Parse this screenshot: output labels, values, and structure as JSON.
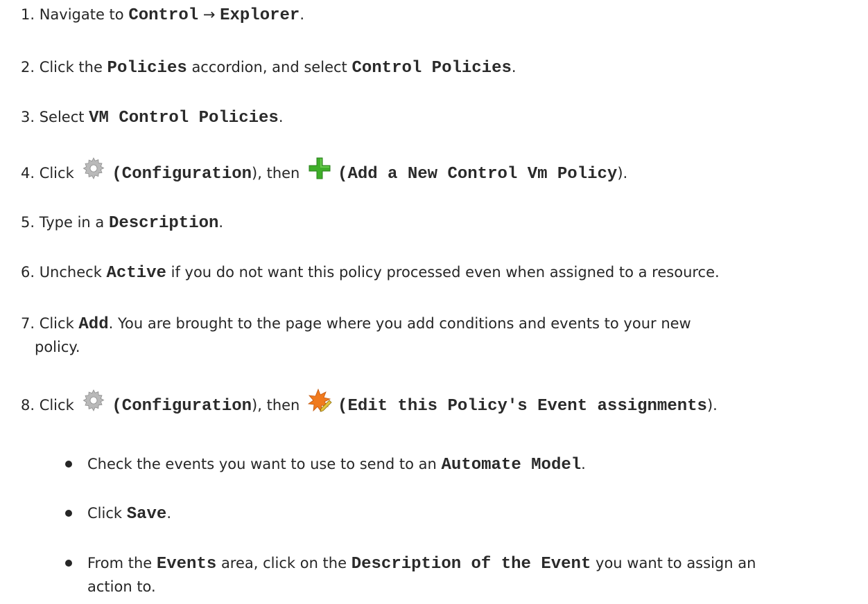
{
  "steps": [
    {
      "num": "1.",
      "parts": {
        "a": "Navigate to ",
        "b": "Control",
        "c": " → ",
        "d": "Explorer",
        "e": "."
      }
    },
    {
      "num": "2.",
      "parts": {
        "a": "Click the ",
        "b": "Policies",
        "c": " accordion, and select ",
        "d": "Control Policies",
        "e": "."
      }
    },
    {
      "num": "3.",
      "parts": {
        "a": "Select ",
        "b": "VM Control Policies",
        "c": "."
      }
    },
    {
      "num": "4.",
      "parts": {
        "a": "Click ",
        "b": "(Configuration",
        "c": "), then ",
        "d": "(Add a New Control Vm Policy",
        "e": ")."
      }
    },
    {
      "num": "5.",
      "parts": {
        "a": "Type in a ",
        "b": "Description",
        "c": "."
      }
    },
    {
      "num": "6.",
      "parts": {
        "a": "Uncheck ",
        "b": "Active",
        "c": " if you do not want this policy processed even when assigned to a resource."
      }
    },
    {
      "num": "7.",
      "parts": {
        "a": "Click ",
        "b": "Add",
        "c": ". You are brought to the page where you add conditions and events to your new",
        "line2": "policy."
      }
    },
    {
      "num": "8.",
      "parts": {
        "a": "Click ",
        "b": "(Configuration",
        "c": "), then ",
        "d": "(Edit this Policy's Event assignments",
        "e": ")."
      }
    }
  ],
  "bullets": [
    {
      "a": "Check the events you want to use to send to an ",
      "b": "Automate Model",
      "c": "."
    },
    {
      "a": "Click ",
      "b": "Save",
      "c": "."
    },
    {
      "a": "From the ",
      "b": "Events",
      "c": " area, click on the ",
      "d": "Description of the Event",
      "e": " you want to assign an",
      "line2": "action to."
    }
  ],
  "icons": {
    "configuration": "gear-icon",
    "add": "plus-icon",
    "edit_events": "edit-event-icon"
  },
  "colors": {
    "text": "#262626",
    "gear": "#b8b8b8",
    "plus": "#3fae2a",
    "star": "#f07a1e"
  }
}
